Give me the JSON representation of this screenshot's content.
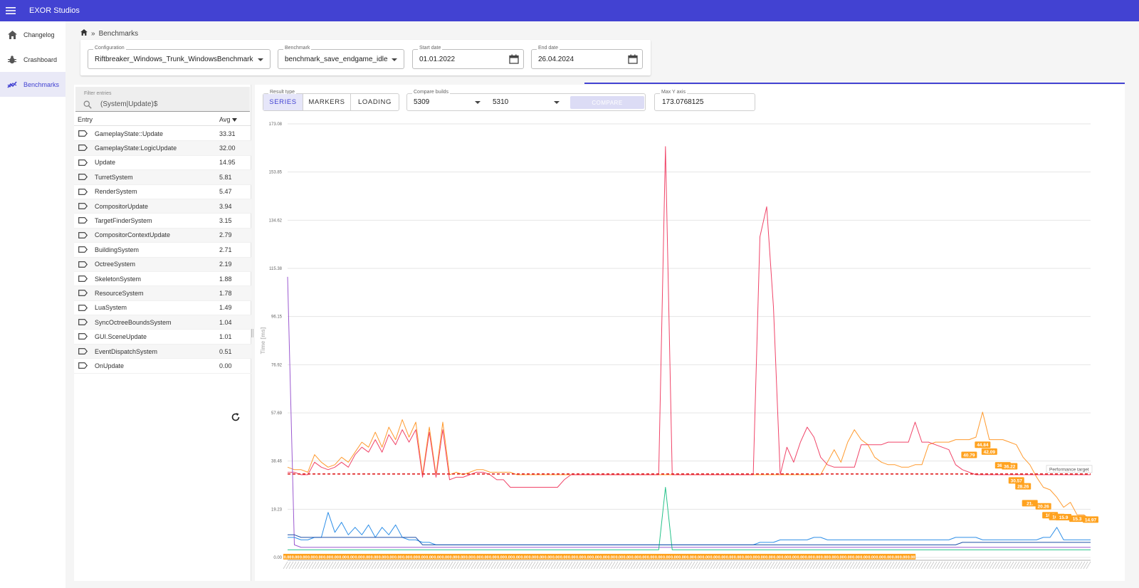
{
  "app": {
    "title": "EXOR Studios"
  },
  "sidebar": {
    "items": [
      {
        "label": "Changelog",
        "icon": "home-icon"
      },
      {
        "label": "Crashboard",
        "icon": "bug-icon"
      },
      {
        "label": "Benchmarks",
        "icon": "chart-icon"
      }
    ]
  },
  "breadcrumb": {
    "separator": "»",
    "current": "Benchmarks"
  },
  "filters": {
    "configuration": {
      "label": "Configuration",
      "value": "Riftbreaker_Windows_Trunk_WindowsBenchmark"
    },
    "benchmark": {
      "label": "Benchmark",
      "value": "benchmark_save_endgame_idle"
    },
    "start_date": {
      "label": "Start date",
      "value": "01.01.2022"
    },
    "end_date": {
      "label": "End date",
      "value": "26.04.2024"
    }
  },
  "entries": {
    "filter_label": "Filter entries",
    "filter_value": "(System|Update)$",
    "col_entry": "Entry",
    "col_avg": "Avg",
    "rows": [
      {
        "name": "GameplayState::Update",
        "avg": "33.31"
      },
      {
        "name": "GameplayState:LogicUpdate",
        "avg": "32.00"
      },
      {
        "name": "Update",
        "avg": "14.95"
      },
      {
        "name": "TurretSystem",
        "avg": "5.81"
      },
      {
        "name": "RenderSystem",
        "avg": "5.47"
      },
      {
        "name": "CompositorUpdate",
        "avg": "3.94"
      },
      {
        "name": "TargetFinderSystem",
        "avg": "3.15"
      },
      {
        "name": "CompositorContextUpdate",
        "avg": "2.79"
      },
      {
        "name": "BuildingSystem",
        "avg": "2.71"
      },
      {
        "name": "OctreeSystem",
        "avg": "2.19"
      },
      {
        "name": "SkeletonSystem",
        "avg": "1.88"
      },
      {
        "name": "ResourceSystem",
        "avg": "1.78"
      },
      {
        "name": "LuaSystem",
        "avg": "1.49"
      },
      {
        "name": "SyncOctreeBoundsSystem",
        "avg": "1.04"
      },
      {
        "name": "GUI.SceneUpdate",
        "avg": "1.01"
      },
      {
        "name": "EventDispatchSystem",
        "avg": "0.51"
      },
      {
        "name": "OnUpdate",
        "avg": "0.00"
      }
    ]
  },
  "controls": {
    "result_type_label": "Result type",
    "result_types": [
      "SERIES",
      "MARKERS",
      "LOADING"
    ],
    "selected_result_type": "SERIES",
    "compare_label": "Compare builds",
    "build_a": "5309",
    "build_b": "5310",
    "compare_button": "COMPARE",
    "max_y_label": "Max Y axis",
    "max_y_value": "173.0768125"
  },
  "chart_data": {
    "type": "line",
    "ylabel": "Time [ms]",
    "ylim": [
      0,
      173.08
    ],
    "y_ticks": [
      "173.08",
      "153.85",
      "134.62",
      "115.38",
      "96.15",
      "76.92",
      "57.69",
      "38.46",
      "19.23",
      "0.00"
    ],
    "performance_target": {
      "label": "Performance target",
      "value": 33.3,
      "color": "#e02020"
    },
    "n_points": 120,
    "series": [
      {
        "color": "#ff9a2e",
        "values": [
          36,
          35,
          35,
          34,
          41,
          38,
          36,
          37,
          40,
          38,
          42,
          46,
          44,
          50,
          44,
          52,
          47,
          55,
          48,
          54,
          33,
          52,
          33,
          54,
          33,
          34,
          33,
          34,
          35,
          35,
          34,
          34,
          34,
          34,
          33,
          33,
          33,
          33,
          33,
          33,
          33,
          33,
          33,
          33,
          33,
          33,
          33,
          33,
          33,
          33,
          33,
          33,
          33,
          33,
          33,
          33,
          33,
          33,
          33,
          33,
          33,
          33,
          33,
          33,
          33,
          33,
          33,
          33,
          33,
          33,
          33,
          33,
          33,
          33,
          33,
          33,
          33,
          33,
          33,
          33,
          38,
          43,
          38,
          46,
          51,
          47,
          45,
          40,
          38,
          37,
          37,
          36,
          36,
          37,
          37,
          45,
          46,
          46,
          46,
          47,
          47,
          47,
          48,
          58,
          47,
          47,
          47,
          46,
          45,
          40,
          37,
          32,
          28,
          27,
          24,
          20,
          22,
          17,
          17,
          15
        ]
      },
      {
        "color": "#f04468",
        "values": [
          34,
          34,
          33,
          33,
          38,
          36,
          35,
          36,
          38,
          36,
          41,
          44,
          42,
          47,
          42,
          49,
          45,
          51,
          46,
          51,
          32,
          50,
          32,
          51,
          31,
          32,
          32,
          33,
          34,
          34,
          33,
          31,
          31,
          28,
          28,
          28,
          28,
          28,
          28,
          28,
          28,
          31,
          33,
          33,
          33,
          33,
          33,
          33,
          33,
          33,
          33,
          33,
          33,
          33,
          33,
          33,
          164,
          33,
          33,
          33,
          33,
          33,
          33,
          33,
          33,
          33,
          33,
          33,
          33,
          33,
          128,
          140,
          100,
          33,
          44,
          38,
          46,
          52,
          48,
          40,
          37,
          36,
          36,
          36,
          36,
          45,
          45,
          45,
          45,
          46,
          46,
          46,
          46,
          54,
          46,
          46,
          45,
          44,
          43,
          37,
          35,
          34,
          33,
          33,
          33,
          33,
          33,
          33,
          33,
          33,
          33,
          33,
          33,
          33,
          33,
          33,
          33,
          33,
          33,
          33
        ]
      },
      {
        "color": "#9b59d0",
        "values": [
          112,
          5,
          4,
          4,
          4,
          4,
          4,
          4,
          4,
          4,
          4,
          4,
          4,
          4,
          4,
          4,
          4,
          4,
          4,
          4,
          4,
          4,
          4,
          4,
          4,
          4,
          4,
          4,
          4,
          4,
          4,
          4,
          4,
          4,
          4,
          4,
          4,
          4,
          4,
          4,
          4,
          4,
          4,
          4,
          4,
          4,
          4,
          4,
          4,
          4,
          4,
          4,
          4,
          4,
          4,
          4,
          4,
          4,
          4,
          4,
          4,
          4,
          4,
          4,
          4,
          4,
          4,
          4,
          4,
          4,
          4,
          4,
          4,
          4,
          4,
          4,
          4,
          4,
          4,
          4,
          4,
          4,
          4,
          4,
          4,
          4,
          4,
          4,
          4,
          4,
          4,
          4,
          4,
          4,
          4,
          4,
          4,
          4,
          4,
          4,
          4,
          4,
          4,
          4,
          4,
          4,
          4,
          4,
          4,
          4,
          4,
          4,
          4,
          4,
          4,
          4,
          4,
          4,
          4,
          4
        ]
      },
      {
        "color": "#2e8fe8",
        "values": [
          8,
          8,
          7,
          7,
          8,
          8,
          18,
          10,
          14,
          9,
          12,
          9,
          13,
          8,
          12,
          9,
          13,
          8,
          7,
          7,
          6,
          6,
          5,
          5,
          5,
          5,
          5,
          5,
          5,
          5,
          5,
          5,
          5,
          5,
          5,
          5,
          5,
          5,
          5,
          5,
          5,
          5,
          5,
          5,
          5,
          5,
          5,
          5,
          5,
          5,
          5,
          5,
          5,
          5,
          5,
          5,
          5,
          5,
          5,
          5,
          5,
          5,
          5,
          5,
          5,
          5,
          5,
          5,
          5,
          5,
          6,
          6,
          6,
          7,
          7,
          7,
          7,
          7,
          8,
          8,
          7,
          7,
          7,
          7,
          7,
          7,
          7,
          7,
          7,
          7,
          7,
          7,
          7,
          7,
          7,
          7,
          7,
          7,
          7,
          8,
          8,
          8,
          8,
          7,
          7,
          7,
          7,
          7,
          7,
          7,
          7,
          7,
          8,
          8,
          12,
          7,
          7,
          7,
          7,
          7
        ]
      },
      {
        "color": "#25c28a",
        "values": [
          3,
          3,
          3,
          3,
          3,
          3,
          3,
          3,
          3,
          3,
          3,
          3,
          3,
          3,
          3,
          3,
          3,
          3,
          3,
          3,
          3,
          3,
          3,
          3,
          3,
          3,
          3,
          3,
          3,
          3,
          3,
          3,
          3,
          3,
          3,
          3,
          3,
          3,
          3,
          3,
          3,
          3,
          3,
          3,
          3,
          3,
          3,
          3,
          3,
          3,
          3,
          3,
          3,
          3,
          3,
          3,
          28,
          3,
          3,
          3,
          3,
          3,
          3,
          3,
          3,
          3,
          3,
          3,
          3,
          3,
          3,
          3,
          3,
          3,
          3,
          3,
          3,
          3,
          3,
          3,
          3,
          3,
          3,
          3,
          3,
          3,
          3,
          3,
          3,
          3,
          3,
          3,
          3,
          3,
          3,
          3,
          3,
          3,
          3,
          3,
          3,
          3,
          3,
          3,
          3,
          3,
          3,
          3,
          3,
          3,
          3,
          3,
          3,
          3,
          3,
          3,
          3,
          3,
          3,
          3
        ]
      },
      {
        "color": "#1c4fa8",
        "values": [
          9,
          9,
          8,
          8,
          8,
          8,
          8,
          8,
          8,
          8,
          8,
          8,
          8,
          8,
          8,
          8,
          8,
          8,
          8,
          8,
          5,
          5,
          5,
          5,
          5,
          5,
          5,
          5,
          5,
          5,
          5,
          5,
          5,
          5,
          5,
          5,
          5,
          5,
          5,
          5,
          5,
          5,
          5,
          5,
          5,
          5,
          5,
          5,
          5,
          5,
          5,
          5,
          5,
          5,
          5,
          5,
          5,
          5,
          5,
          5,
          5,
          5,
          5,
          5,
          5,
          5,
          5,
          5,
          5,
          5,
          5,
          5,
          5,
          5,
          5,
          5,
          5,
          5,
          5,
          5,
          5,
          5,
          5,
          5,
          5,
          5,
          5,
          5,
          5,
          5,
          5,
          5,
          5,
          5,
          5,
          5,
          5,
          5,
          5,
          5,
          6,
          6,
          6,
          6,
          6,
          6,
          6,
          6,
          6,
          6,
          6,
          6,
          6,
          6,
          6,
          6,
          6,
          6,
          6,
          6
        ]
      }
    ],
    "data_labels": [
      {
        "text": "40.79",
        "value": 40.79,
        "index": 101
      },
      {
        "text": "44.84",
        "value": 44.84,
        "index": 103
      },
      {
        "text": "42.09",
        "value": 42.09,
        "index": 104
      },
      {
        "text": "36.62",
        "value": 36.62,
        "index": 106
      },
      {
        "text": "36.22",
        "value": 36.22,
        "index": 107
      },
      {
        "text": "30.57",
        "value": 30.57,
        "index": 108
      },
      {
        "text": "28.26",
        "value": 28.26,
        "index": 109
      },
      {
        "text": "21.",
        "value": 21.5,
        "index": 110
      },
      {
        "text": "20.26",
        "value": 20.26,
        "index": 112
      },
      {
        "text": "16.7",
        "value": 16.7,
        "index": 113
      },
      {
        "text": "16.0",
        "value": 16.0,
        "index": 114
      },
      {
        "text": "15.9",
        "value": 15.9,
        "index": 115
      },
      {
        "text": "15.3",
        "value": 15.3,
        "index": 117
      },
      {
        "text": "14.97",
        "value": 14.97,
        "index": 119
      }
    ],
    "zero_label": "0.00"
  }
}
